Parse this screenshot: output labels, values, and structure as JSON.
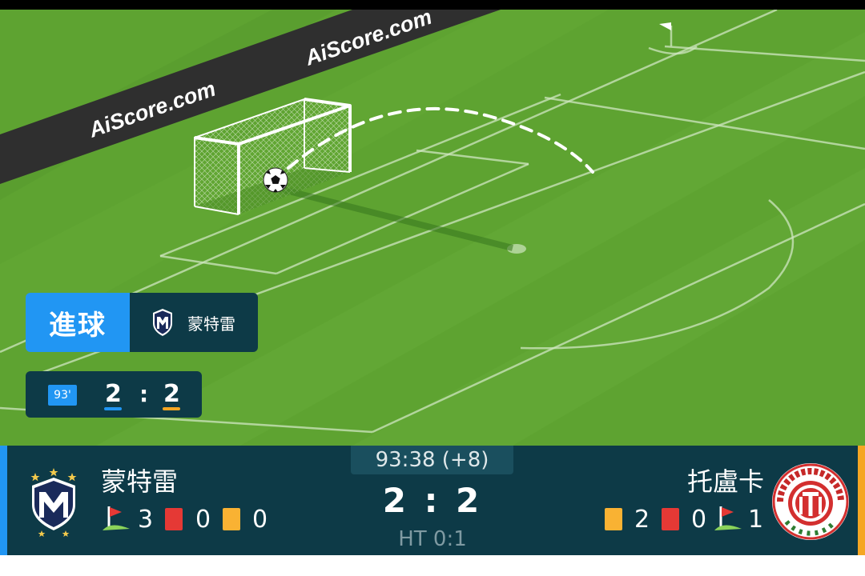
{
  "event": {
    "label": "進球",
    "team": "蒙特雷"
  },
  "mini_score": {
    "minute": "93'",
    "home": "2",
    "separator": ":",
    "away": "2"
  },
  "scoreboard": {
    "clock": "93:38 (+8)",
    "score": "2 : 2",
    "halftime": "HT 0:1",
    "home": {
      "name": "蒙特雷",
      "corners": "3",
      "red_cards": "0",
      "yellow_cards": "0",
      "crest": "monterrey-crest-icon"
    },
    "away": {
      "name": "托盧卡",
      "yellow_cards": "2",
      "red_cards": "0",
      "corners": "1",
      "crest": "toluca-crest-icon"
    }
  },
  "pitch": {
    "ad_board_text": [
      "AiScore.com",
      "AiScore.com"
    ]
  },
  "colors": {
    "home": "#2196f3",
    "away": "#f5a623",
    "panel": "#0d3a47",
    "pitch": "#5ea331",
    "red_card": "#e53935",
    "yellow_card": "#f9b233"
  }
}
